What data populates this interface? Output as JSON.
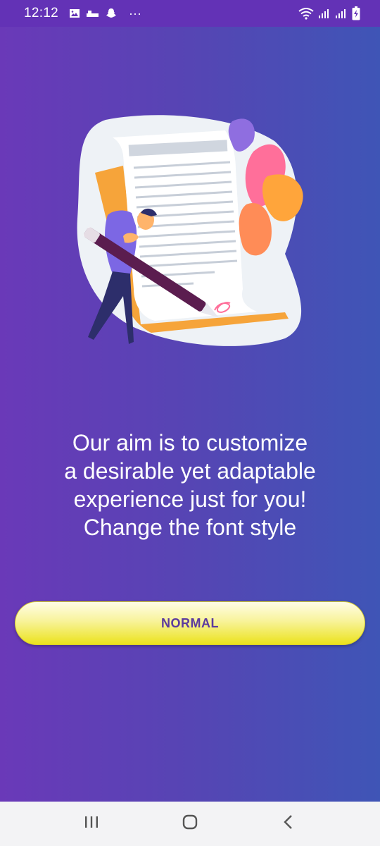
{
  "status_bar": {
    "time": "12:12",
    "icons": [
      "image-icon",
      "sim-icon",
      "snapchat-icon",
      "more-dots-icon",
      "wifi-icon",
      "signal-icon",
      "signal-icon",
      "battery-charging-icon"
    ],
    "more": "···"
  },
  "illustration": {
    "description_icon": "writing-contract-illustration"
  },
  "main": {
    "headline": "Our aim is to customize\na desirable yet adaptable\nexperience just for you!\nChange the font style",
    "button_label": "NORMAL"
  },
  "nav_bar": {
    "recent_icon": "recent-apps-icon",
    "home_icon": "home-icon",
    "back_icon": "back-icon"
  },
  "colors": {
    "status_bar": "#6332b6",
    "gradient_left": "#6a39b8",
    "gradient_right": "#3f55b6",
    "button_yellow": "#ebe21c",
    "button_text": "#5b3a9e",
    "nav_bar": "#f3f3f5"
  }
}
